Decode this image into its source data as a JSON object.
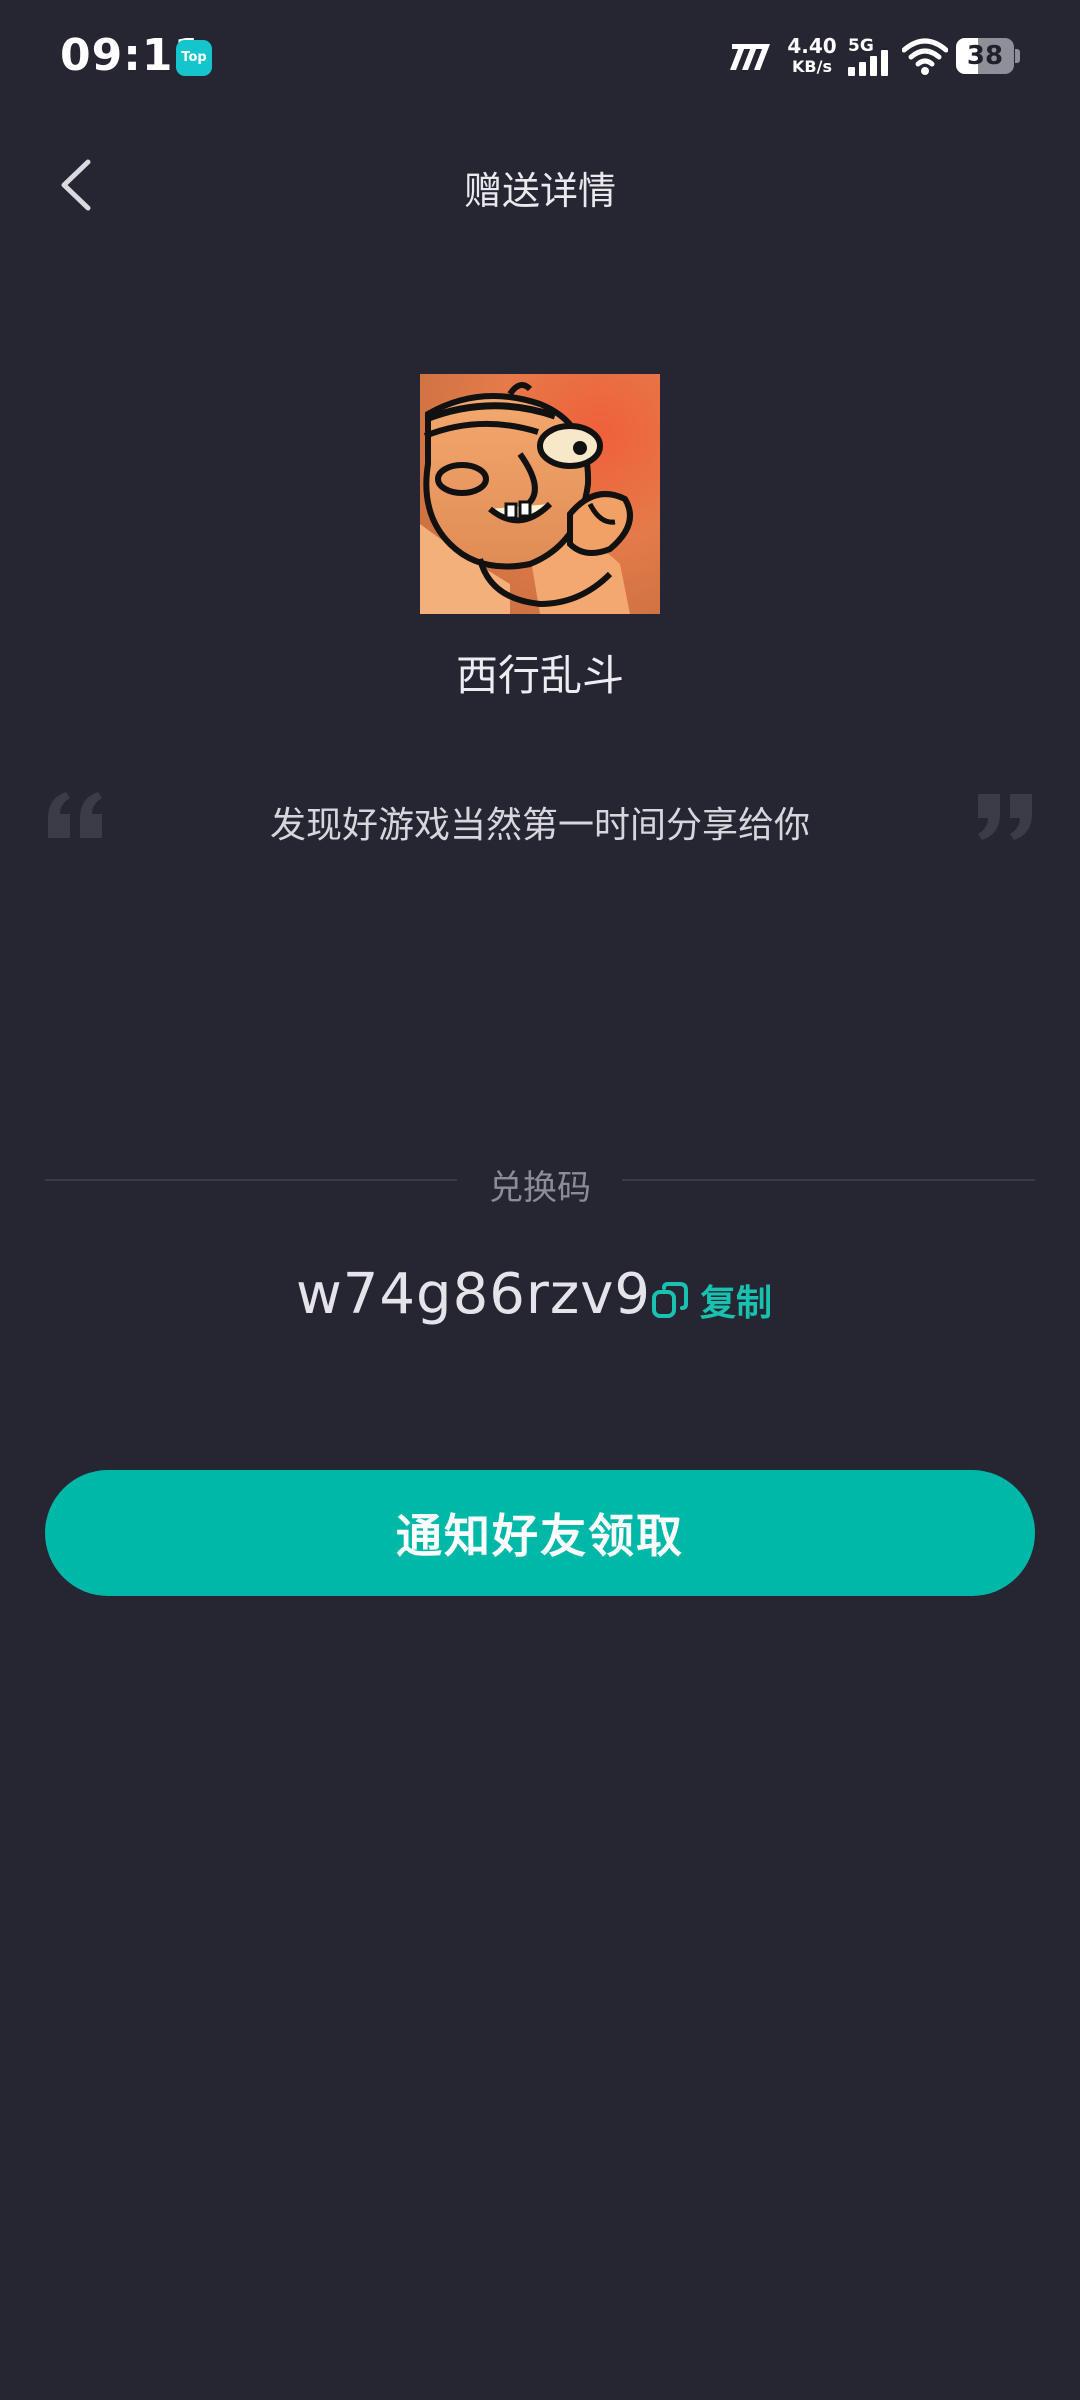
{
  "status_bar": {
    "time": "09:11",
    "app_badge": "Top",
    "net_speed_value": "4.40",
    "net_speed_unit": "KB/s",
    "network_type": "5G",
    "battery_level": "38"
  },
  "header": {
    "title": "赠送详情"
  },
  "game": {
    "name": "西行乱斗"
  },
  "message": {
    "text": "发现好游戏当然第一时间分享给你"
  },
  "redeem": {
    "label": "兑换码",
    "code": "w74g86rzv9",
    "copy_label": "复制"
  },
  "actions": {
    "notify_label": "通知好友领取"
  },
  "colors": {
    "background": "#252631",
    "accent": "#00b8a7",
    "copy_text": "#19c2b0"
  }
}
